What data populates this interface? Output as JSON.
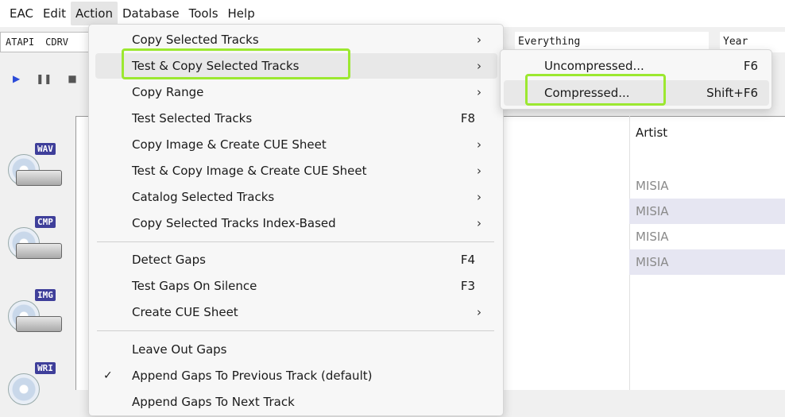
{
  "menubar": {
    "items": [
      {
        "label": "EAC"
      },
      {
        "label": "Edit"
      },
      {
        "label": "Action"
      },
      {
        "label": "Database"
      },
      {
        "label": "Tools"
      },
      {
        "label": "Help"
      }
    ]
  },
  "toolbar": {
    "drive_label_1": "ATAPI",
    "drive_label_2": "CDRV",
    "genre_value": "Everything",
    "year_label": "Year"
  },
  "side_icons": [
    {
      "tag": "WAV"
    },
    {
      "tag": "CMP"
    },
    {
      "tag": "IMG"
    },
    {
      "tag": "WRI"
    }
  ],
  "track_list": {
    "artist_header": "Artist",
    "rows": [
      {
        "artist": "MISIA"
      },
      {
        "artist": "MISIA"
      },
      {
        "artist": "MISIA"
      },
      {
        "artist": "MISIA"
      }
    ]
  },
  "action_menu": {
    "items": [
      {
        "label": "Copy Selected Tracks",
        "arrow": "›"
      },
      {
        "label": "Test & Copy Selected Tracks",
        "arrow": "›"
      },
      {
        "label": "Copy Range",
        "arrow": "›"
      },
      {
        "label": "Test Selected Tracks",
        "accel": "F8"
      },
      {
        "label": "Copy Image & Create CUE Sheet",
        "arrow": "›"
      },
      {
        "label": "Test & Copy Image & Create CUE Sheet",
        "arrow": "›"
      },
      {
        "label": "Catalog Selected Tracks",
        "arrow": "›"
      },
      {
        "label": "Copy Selected Tracks Index-Based",
        "arrow": "›"
      },
      {
        "label": "Detect Gaps",
        "accel": "F4"
      },
      {
        "label": "Test Gaps On Silence",
        "accel": "F3"
      },
      {
        "label": "Create CUE Sheet",
        "arrow": "›"
      },
      {
        "label": "Leave Out Gaps"
      },
      {
        "label": "Append Gaps To Previous Track (default)",
        "check": "✓"
      },
      {
        "label": "Append Gaps To Next Track"
      }
    ]
  },
  "submenu": {
    "items": [
      {
        "label": "Uncompressed...",
        "accel": "F6"
      },
      {
        "label": "Compressed...",
        "accel": "Shift+F6"
      }
    ]
  },
  "colors": {
    "highlight": "#9ce830",
    "accent_blue": "#2b6fc9",
    "alt_row": "#e6e6f2"
  }
}
